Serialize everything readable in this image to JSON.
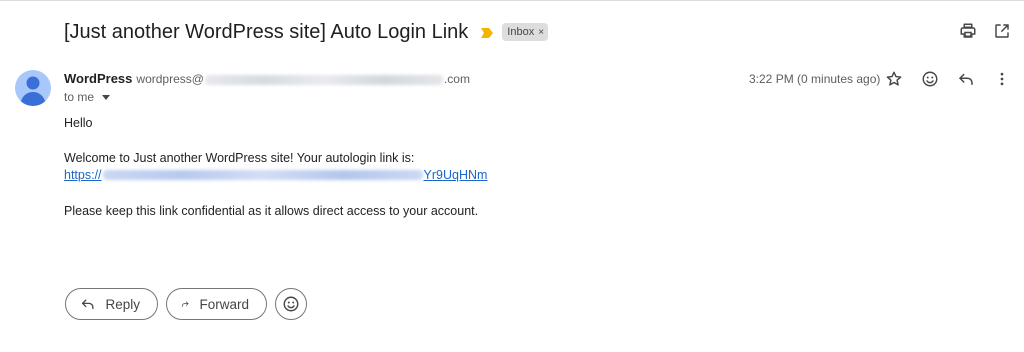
{
  "subject": "[Just another WordPress site] Auto Login Link",
  "label_chip": {
    "text": "Inbox",
    "remove_glyph": "×"
  },
  "icons": {
    "importance": "importance-marker-icon",
    "print": "print-icon",
    "open_new_window": "open-in-new-window-icon",
    "star": "star-icon",
    "emoji": "emoji-reaction-icon",
    "reply": "reply-icon",
    "more": "more-options-icon",
    "avatar": "avatar-person-icon"
  },
  "colors": {
    "importance": "#f4b400",
    "avatar_bg": "#a8c7fa",
    "avatar_fg": "#3a6fd8",
    "link": "#1a66c9"
  },
  "sender": {
    "name": "WordPress",
    "email_prefix": "wordpress@",
    "email_suffix": ".com",
    "to_text": "to me"
  },
  "timestamp": "3:22 PM (0 minutes ago)",
  "body": {
    "greeting": "Hello",
    "welcome": "Welcome to Just another WordPress site! Your autologin link is:",
    "link_prefix": "https://",
    "link_suffix": "Yr9UqHNm",
    "note": "Please keep this link confidential as it allows direct access to your account."
  },
  "actions": {
    "reply_label": "Reply",
    "forward_label": "Forward"
  }
}
